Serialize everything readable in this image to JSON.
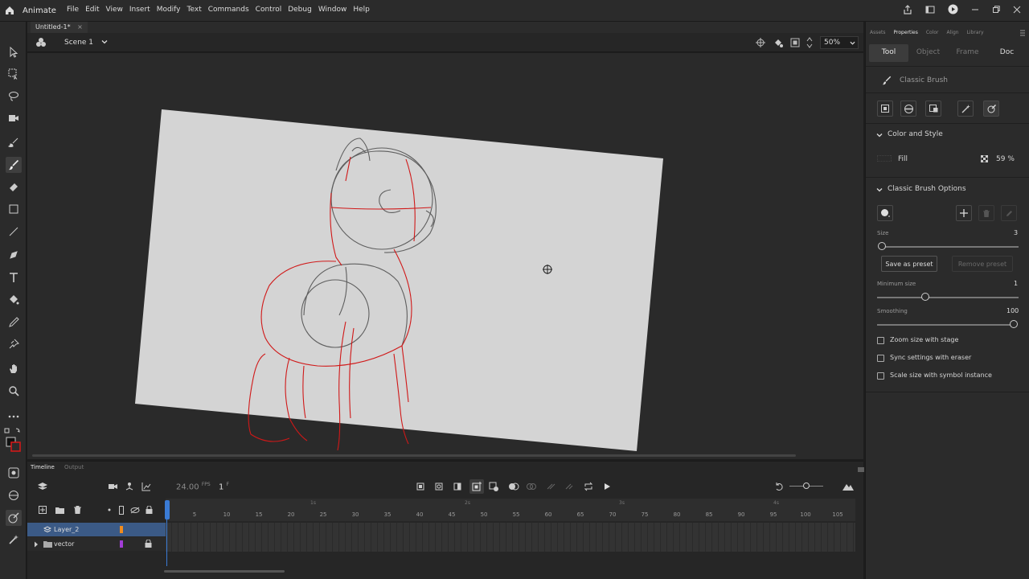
{
  "app": {
    "name": "Animate"
  },
  "menu": [
    "File",
    "Edit",
    "View",
    "Insert",
    "Modify",
    "Text",
    "Commands",
    "Control",
    "Debug",
    "Window",
    "Help"
  ],
  "document": {
    "tab": "Untitled-1*",
    "scene": "Scene 1",
    "zoom": "50%"
  },
  "timeline": {
    "tabs": [
      "Timeline",
      "Output"
    ],
    "fps": "24.00",
    "fps_unit": "FPS",
    "frame": "1",
    "frame_unit": "F",
    "ticks": [
      "5",
      "10",
      "15",
      "20",
      "25",
      "30",
      "35",
      "40",
      "45",
      "50",
      "55",
      "60",
      "65",
      "70",
      "75",
      "80",
      "85",
      "90",
      "95",
      "100",
      "105"
    ],
    "seconds": [
      "1s",
      "2s",
      "3s",
      "4s"
    ],
    "layers": [
      {
        "name": "Layer_2",
        "color": "#f08c1e"
      },
      {
        "name": "vector",
        "color": "#a23dd6"
      }
    ]
  },
  "panel": {
    "tabs": [
      "Assets",
      "Properties",
      "Color",
      "Align",
      "Library"
    ],
    "active_tab": "Properties",
    "subtabs": [
      "Tool",
      "Object",
      "Frame",
      "Doc"
    ],
    "active_subtab": "Tool",
    "tool_name": "Classic Brush",
    "color_style": {
      "header": "Color and Style",
      "fill_label": "Fill",
      "fill_alpha": "59 %"
    },
    "brush_options": {
      "header": "Classic Brush Options",
      "size_label": "Size",
      "size_value": "3",
      "save_preset": "Save as preset",
      "remove_preset": "Remove preset",
      "min_size_label": "Minimum size",
      "min_size_value": "1",
      "smoothing_label": "Smoothing",
      "smoothing_value": "100",
      "checkboxes": [
        "Zoom size with stage",
        "Sync settings with eraser",
        "Scale size with symbol instance"
      ]
    }
  },
  "colors": {
    "accent": "#3a7bd5",
    "sketch_red": "#d01818",
    "sketch_gray": "#4a4a4a",
    "paper": "#d4d4d4"
  }
}
